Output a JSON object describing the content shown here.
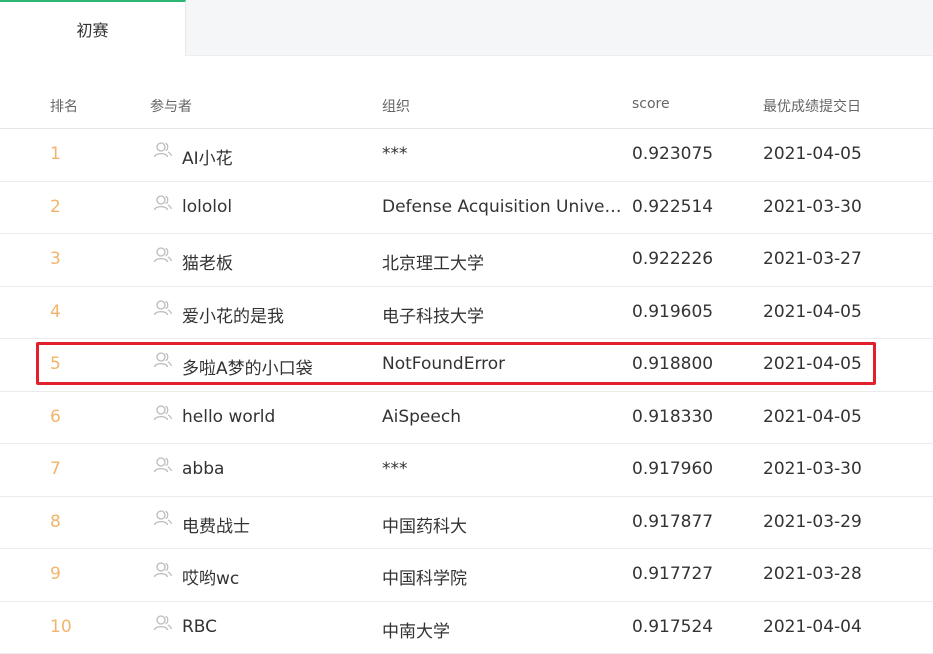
{
  "tabs": [
    {
      "label": "初赛"
    }
  ],
  "headers": {
    "rank": "排名",
    "participant": "参与者",
    "org": "组织",
    "score": "score",
    "date": "最优成绩提交日"
  },
  "rows": [
    {
      "rank": "1",
      "name": "AI小花",
      "org": "***",
      "score": "0.923075",
      "date": "2021-04-05"
    },
    {
      "rank": "2",
      "name": "lololol",
      "org": "Defense Acquisition Univer...",
      "score": "0.922514",
      "date": "2021-03-30"
    },
    {
      "rank": "3",
      "name": "猫老板",
      "org": "北京理工大学",
      "score": "0.922226",
      "date": "2021-03-27"
    },
    {
      "rank": "4",
      "name": "爱小花的是我",
      "org": "电子科技大学",
      "score": "0.919605",
      "date": "2021-04-05"
    },
    {
      "rank": "5",
      "name": "多啦A梦的小口袋",
      "org": "NotFoundError",
      "score": "0.918800",
      "date": "2021-04-05"
    },
    {
      "rank": "6",
      "name": "hello world",
      "org": "AiSpeech",
      "score": "0.918330",
      "date": "2021-04-05"
    },
    {
      "rank": "7",
      "name": "abba",
      "org": "***",
      "score": "0.917960",
      "date": "2021-03-30"
    },
    {
      "rank": "8",
      "name": "电费战士",
      "org": "中国药科大",
      "score": "0.917877",
      "date": "2021-03-29"
    },
    {
      "rank": "9",
      "name": "哎哟wc",
      "org": "中国科学院",
      "score": "0.917727",
      "date": "2021-03-28"
    },
    {
      "rank": "10",
      "name": "RBC",
      "org": "中南大学",
      "score": "0.917524",
      "date": "2021-04-04"
    }
  ],
  "icons": {
    "participant": "user-icon"
  },
  "colors": {
    "accent": "#2bb673",
    "rank": "#f2b46b",
    "highlight": "#e0202b"
  }
}
